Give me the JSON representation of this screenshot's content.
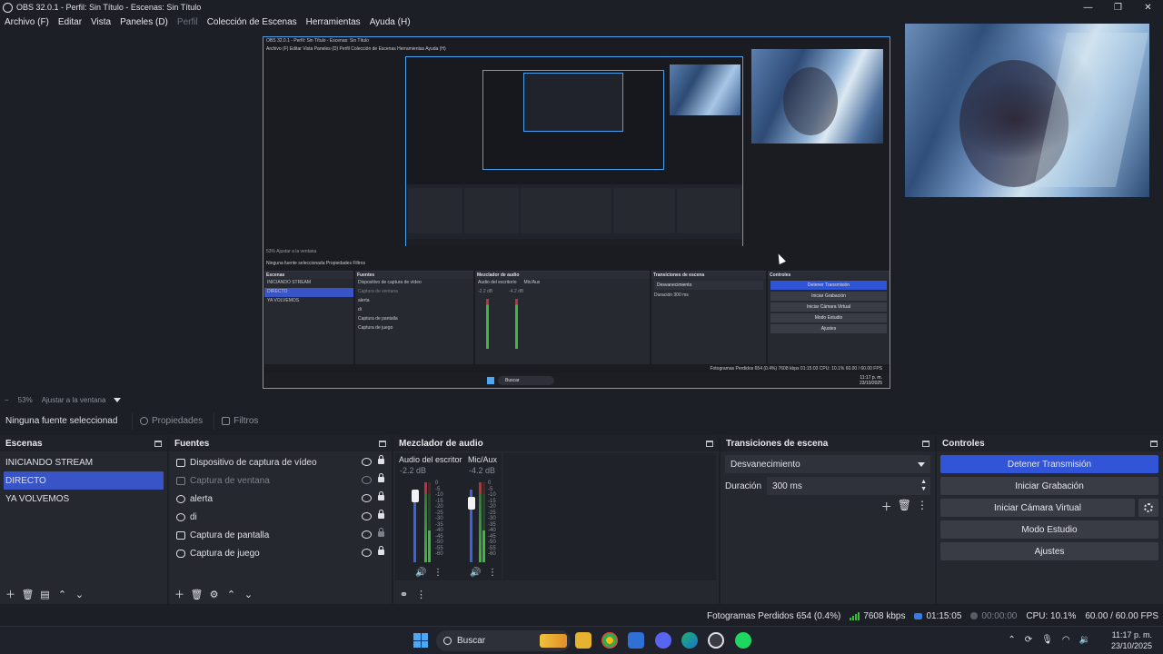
{
  "window": {
    "title": "OBS 32.0.1 - Perfil: Sin Título - Escenas: Sin Título",
    "minimize": "—",
    "maximize": "❐",
    "close": "✕"
  },
  "menu": {
    "items": [
      "Archivo (F)",
      "Editar",
      "Vista",
      "Paneles (D)",
      "Perfil",
      "Colección de Escenas",
      "Herramientas",
      "Ayuda (H)"
    ]
  },
  "zoom": {
    "minus": "−",
    "level": "53%",
    "fit_label": "Ajustar a la ventana"
  },
  "context_bar": {
    "source_label": "Ninguna fuente seleccionad",
    "properties_label": "Propiedades",
    "filters_label": "Filtros"
  },
  "scenes": {
    "title": "Escenas",
    "items": [
      {
        "label": "INICIANDO STREAM",
        "selected": false
      },
      {
        "label": "DIRECTO",
        "selected": true
      },
      {
        "label": "YA VOLVEMOS",
        "selected": false
      }
    ]
  },
  "sources": {
    "title": "Fuentes",
    "items": [
      {
        "label": "Dispositivo de captura de vídeo",
        "icon": "camera-icon",
        "visible": true,
        "locked": true
      },
      {
        "label": "Captura de ventana",
        "icon": "window-icon",
        "visible": false,
        "locked": true
      },
      {
        "label": "alerta",
        "icon": "globe-icon",
        "visible": true,
        "locked": true
      },
      {
        "label": "di",
        "icon": "globe-icon",
        "visible": true,
        "locked": true
      },
      {
        "label": "Captura de pantalla",
        "icon": "monitor-icon",
        "visible": true,
        "locked": false
      },
      {
        "label": "Captura de juego",
        "icon": "gamepad-icon",
        "visible": true,
        "locked": true
      }
    ]
  },
  "mixer": {
    "title": "Mezclador de audio",
    "channels": [
      {
        "name": "Audio del escritorio",
        "db": "-2.2 dB",
        "level": 0.35
      },
      {
        "name": "Mic/Aux",
        "db": "-4.2 dB",
        "level": 0.45
      }
    ],
    "scale": [
      "0",
      "-5",
      "-10",
      "-15",
      "-20",
      "-25",
      "-30",
      "-35",
      "-40",
      "-45",
      "-50",
      "-55",
      "-60"
    ]
  },
  "transitions": {
    "title": "Transiciones de escena",
    "selected": "Desvanecimiento",
    "duration_label": "Duración",
    "duration_value": "300 ms"
  },
  "controls": {
    "title": "Controles",
    "stop_stream": "Detener Transmisión",
    "start_recording": "Iniciar Grabación",
    "start_virtual_cam": "Iniciar Cámara Virtual",
    "studio_mode": "Modo Estudio",
    "settings": "Ajustes"
  },
  "status": {
    "dropped_frames": "Fotogramas Perdidos 654 (0.4%)",
    "bitrate": "7608 kbps",
    "stream_time": "01:15:05",
    "record_time": "00:00:00",
    "cpu": "CPU: 10.1%",
    "fps": "60.00 / 60.00 FPS"
  },
  "taskbar": {
    "search_placeholder": "Buscar",
    "time": "11:17 p. m.",
    "date": "23/10/2025"
  },
  "nested_preview": {
    "title": "OBS 32.0.1 - Perfil: Sin Título - Escenas: Sin Título",
    "menu": "Archivo (F)   Editar   Vista   Paneles (D)   Perfil   Colección de Escenas   Herramientas   Ayuda (H)",
    "zoom": "53%     Ajustar a la ventana",
    "ctx": "Ninguna fuente seleccionada     Propiedades     Filtros",
    "scenes_title": "Escenas",
    "scenes": [
      "INICIANDO STREAM",
      "DIRECTO",
      "YA VOLVEMOS"
    ],
    "sources_title": "Fuentes",
    "sources": [
      "Dispositivo de captura de vídeo",
      "Captura de ventana",
      "alerta",
      "di",
      "Captura de pantalla",
      "Captura de juego"
    ],
    "mixer_title": "Mezclador de audio",
    "mixer_ch1": "Audio del escritorio",
    "mixer_ch2": "Mic/Aux",
    "mixer_db1": "-2.2 dB",
    "mixer_db2": "-4.2 dB",
    "trans_title": "Transiciones de escena",
    "trans_selected": "Desvanecimiento",
    "trans_dur": "Duración     300 ms",
    "ctl_title": "Controles",
    "ctl_buttons": [
      "Detener Transmisión",
      "Iniciar Grabación",
      "Iniciar Cámara Virtual",
      "Modo Estudio",
      "Ajustes"
    ],
    "status": "Fotogramas Perdidos 654 (0.4%)   7608 kbps   01:15:03   CPU: 10.1%   60.00 / 60.00 FPS",
    "search": "Buscar",
    "time": "11:17 p. m.",
    "date": "23/10/2025"
  }
}
